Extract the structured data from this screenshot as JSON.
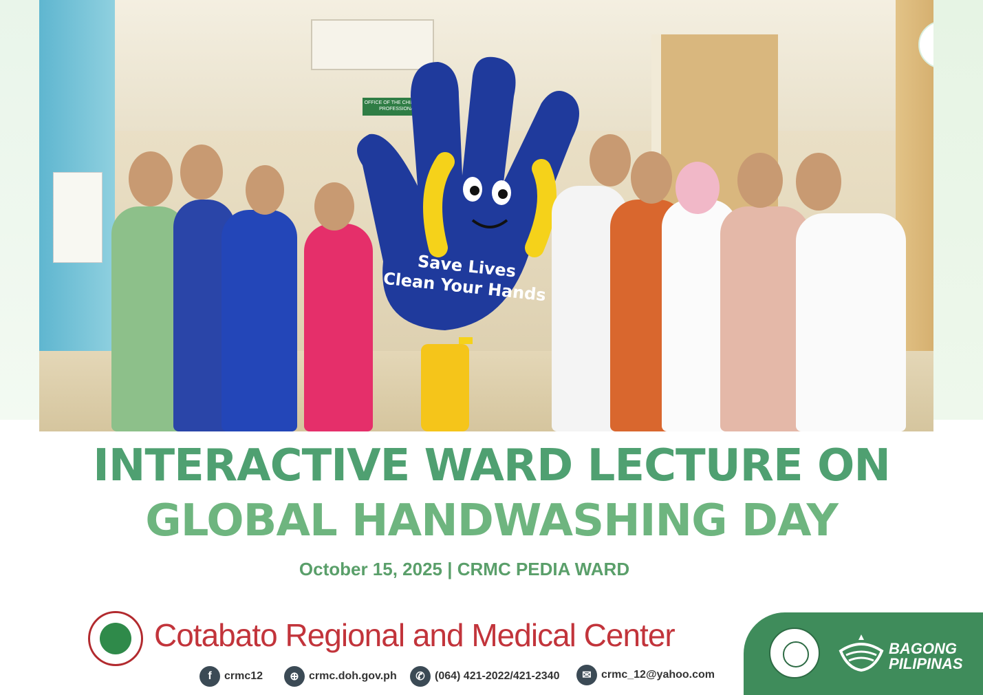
{
  "photo": {
    "sign_text": "OFFICE OF THE CHIEF OF MEDICAL PROFESSIONAL STAFF",
    "mascot_line1": "Save Lives",
    "mascot_line2": "Clean Your Hands"
  },
  "title_line1": "INTERACTIVE WARD LECTURE ON",
  "title_line2": "GLOBAL HANDWASHING DAY",
  "subtitle": "October 15, 2025 | CRMC PEDIA WARD",
  "org_name": "Cotabato Regional and Medical Center",
  "contacts": [
    {
      "icon": "facebook-icon",
      "text": "crmc12"
    },
    {
      "icon": "globe-icon",
      "text": "crmc.doh.gov.ph"
    },
    {
      "icon": "phone-icon",
      "text": "(064) 421-2022/421-2340"
    },
    {
      "icon": "mail-icon",
      "text": "crmc_12@yahoo.com"
    }
  ],
  "bagong_pilipinas": {
    "line1": "BAGONG",
    "line2": "PILIPINAS"
  },
  "colors": {
    "title_green": "#4fa071",
    "org_red": "#c2343b",
    "footer_green": "#3f8c5b",
    "mascot_blue": "#1f3a9c"
  }
}
